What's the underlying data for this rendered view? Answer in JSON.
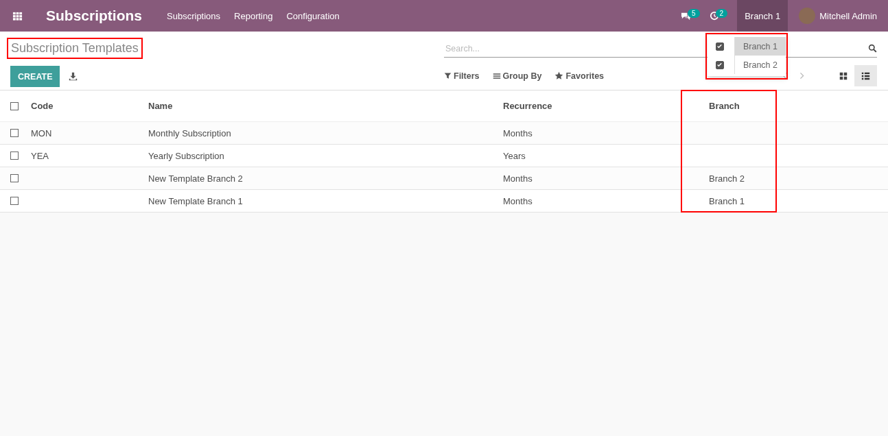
{
  "navbar": {
    "app_name": "Subscriptions",
    "menu": [
      "Subscriptions",
      "Reporting",
      "Configuration"
    ],
    "messages_count": "5",
    "activities_count": "2",
    "company": {
      "label": "Branch 1",
      "open": true
    },
    "user": "Mitchell Admin"
  },
  "company_menu": [
    {
      "label": "Branch 1",
      "checked": true,
      "selected": true
    },
    {
      "label": "Branch 2",
      "checked": true,
      "selected": false
    }
  ],
  "breadcrumb": "Subscription Templates",
  "create_button": "CREATE",
  "search": {
    "placeholder": "Search..."
  },
  "search_options": [
    {
      "kind": "filter",
      "label": "Filters"
    },
    {
      "kind": "group",
      "label": "Group By"
    },
    {
      "kind": "favorite",
      "label": "Favorites"
    }
  ],
  "views": [
    {
      "kind": "kanban",
      "selected": false
    },
    {
      "kind": "list",
      "selected": true
    }
  ],
  "table": {
    "all_checked": false,
    "columns": [
      "Code",
      "Name",
      "Recurrence",
      "Branch"
    ],
    "rows": [
      {
        "checked": false,
        "cells": [
          "MON",
          "Monthly Subscription",
          "Months",
          ""
        ]
      },
      {
        "checked": false,
        "cells": [
          "YEA",
          "Yearly Subscription",
          "Years",
          ""
        ]
      },
      {
        "checked": false,
        "cells": [
          "",
          "New Template Branch 2",
          "Months",
          "Branch 2"
        ]
      },
      {
        "checked": false,
        "cells": [
          "",
          "New Template Branch 1",
          "Months",
          "Branch 1"
        ]
      }
    ]
  }
}
